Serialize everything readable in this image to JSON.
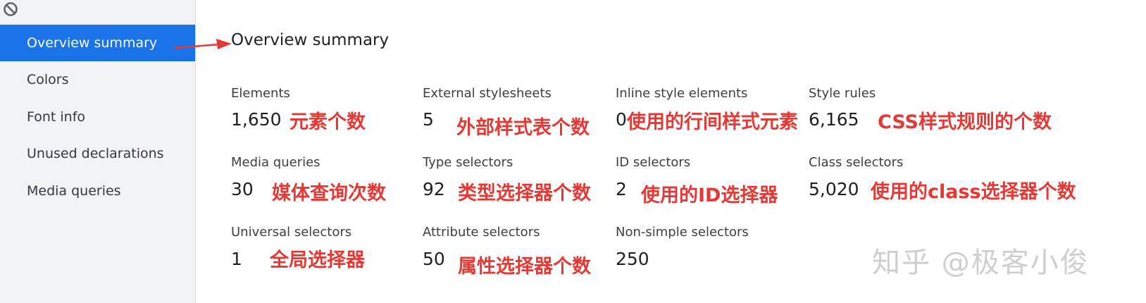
{
  "sidebar": {
    "items": [
      {
        "label": "Overview summary"
      },
      {
        "label": "Colors"
      },
      {
        "label": "Font info"
      },
      {
        "label": "Unused declarations"
      },
      {
        "label": "Media queries"
      }
    ],
    "selected_index": 0,
    "accent_color": "#1a73e8",
    "clear_icon": "block-icon"
  },
  "main": {
    "title": "Overview summary",
    "metrics": [
      {
        "label": "Elements",
        "value": "1,650",
        "annotation": "元素个数"
      },
      {
        "label": "External stylesheets",
        "value": "5",
        "annotation": "外部样式表个数"
      },
      {
        "label": "Inline style elements",
        "value": "0",
        "annotation": "使用的行间样式元素"
      },
      {
        "label": "Style rules",
        "value": "6,165",
        "annotation": "CSS样式规则的个数"
      },
      {
        "label": "Media queries",
        "value": "30",
        "annotation": "媒体查询次数"
      },
      {
        "label": "Type selectors",
        "value": "92",
        "annotation": "类型选择器个数"
      },
      {
        "label": "ID selectors",
        "value": "2",
        "annotation": "使用的ID选择器"
      },
      {
        "label": "Class selectors",
        "value": "5,020",
        "annotation": "使用的class选择器个数"
      },
      {
        "label": "Universal selectors",
        "value": "1",
        "annotation": "全局选择器"
      },
      {
        "label": "Attribute selectors",
        "value": "50",
        "annotation": "属性选择器个数"
      },
      {
        "label": "Non-simple selectors",
        "value": "250",
        "annotation": ""
      }
    ]
  },
  "annotation_color": "#e53935",
  "watermark": "知乎 @极客小俊"
}
